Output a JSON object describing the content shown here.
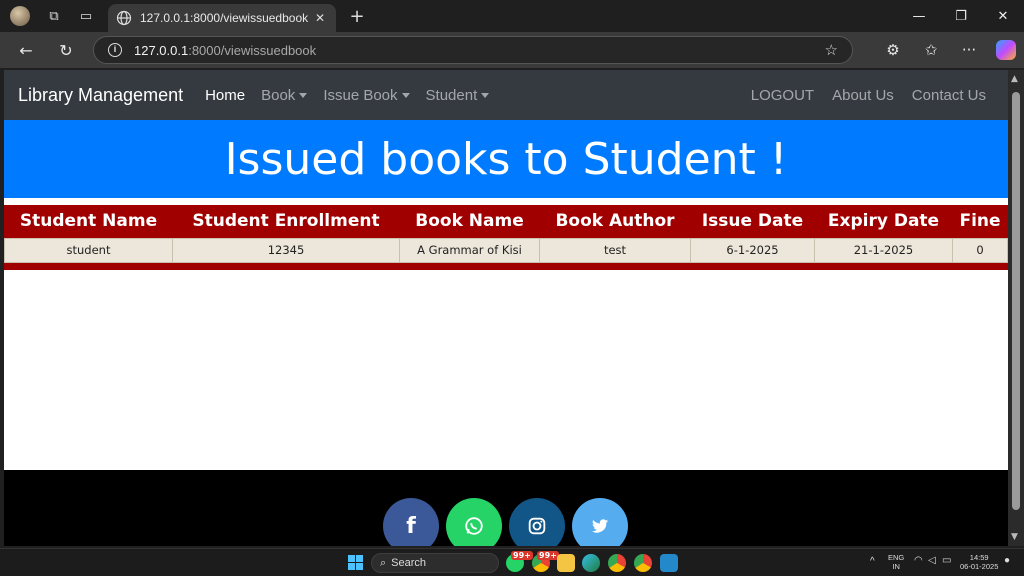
{
  "browser": {
    "tab_title": "127.0.0.1:8000/viewissuedbook",
    "url_host": "127.0.0.1",
    "url_path": ":8000/viewissuedbook"
  },
  "site": {
    "brand": "Library Management",
    "nav": {
      "home": "Home",
      "book": "Book",
      "issue_book": "Issue Book",
      "student": "Student",
      "logout": "LOGOUT",
      "about": "About Us",
      "contact": "Contact Us"
    },
    "banner": "Issued books to Student !",
    "table": {
      "headers": [
        "Student Name",
        "Student Enrollment",
        "Book Name",
        "Book Author",
        "Issue Date",
        "Expiry Date",
        "Fine"
      ],
      "rows": [
        [
          "student",
          "12345",
          "A Grammar of Kisi",
          "test",
          "6-1-2025",
          "21-1-2025",
          "0"
        ]
      ]
    },
    "footer": {
      "icons": [
        "facebook-icon",
        "whatsapp-icon",
        "instagram-icon",
        "twitter-icon"
      ],
      "colors": [
        "#3b5998",
        "#25d366",
        "#125688",
        "#55acee"
      ]
    }
  },
  "taskbar": {
    "search_label": "Search",
    "badge_1": "99+",
    "badge_2": "99+",
    "lang_1": "ENG",
    "lang_2": "IN",
    "time": "14:59",
    "date": "06-01-2025"
  }
}
